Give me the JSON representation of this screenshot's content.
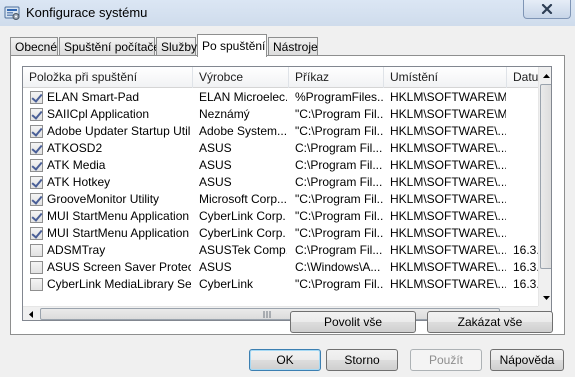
{
  "window": {
    "title": "Konfigurace systému"
  },
  "tabs": [
    {
      "label": "Obecné"
    },
    {
      "label": "Spuštění počítače"
    },
    {
      "label": "Služby"
    },
    {
      "label": "Po spuštění"
    },
    {
      "label": "Nástroje"
    }
  ],
  "active_tab": "Po spuštění",
  "columns": [
    {
      "label": "Položka při spuštění"
    },
    {
      "label": "Výrobce"
    },
    {
      "label": "Příkaz"
    },
    {
      "label": "Umístění"
    },
    {
      "label": "Datu..."
    }
  ],
  "rows": [
    {
      "checked": true,
      "name": "ELAN Smart-Pad",
      "vendor": "ELAN Microelec...",
      "command": "%ProgramFiles...",
      "location": "HKLM\\SOFTWARE\\M...",
      "date": ""
    },
    {
      "checked": true,
      "name": "SAIICpl Application",
      "vendor": "Neznámý",
      "command": "\"C:\\Program Fil...",
      "location": "HKLM\\SOFTWARE\\M...",
      "date": ""
    },
    {
      "checked": true,
      "name": "Adobe Updater Startup Utility",
      "vendor": "Adobe System...",
      "command": "\"C:\\Program Fil...",
      "location": "HKLM\\SOFTWARE\\...",
      "date": ""
    },
    {
      "checked": true,
      "name": "ATKOSD2",
      "vendor": "ASUS",
      "command": "C:\\Program Fil...",
      "location": "HKLM\\SOFTWARE\\...",
      "date": ""
    },
    {
      "checked": true,
      "name": "ATK Media",
      "vendor": "ASUS",
      "command": "C:\\Program Fil...",
      "location": "HKLM\\SOFTWARE\\...",
      "date": ""
    },
    {
      "checked": true,
      "name": "ATK Hotkey",
      "vendor": "ASUS",
      "command": "C:\\Program Fil...",
      "location": "HKLM\\SOFTWARE\\...",
      "date": ""
    },
    {
      "checked": true,
      "name": "GrooveMonitor Utility",
      "vendor": "Microsoft Corp...",
      "command": "\"C:\\Program Fil...",
      "location": "HKLM\\SOFTWARE\\...",
      "date": ""
    },
    {
      "checked": true,
      "name": "MUI StartMenu Application",
      "vendor": "CyberLink Corp.",
      "command": "\"C:\\Program Fil...",
      "location": "HKLM\\SOFTWARE\\...",
      "date": ""
    },
    {
      "checked": true,
      "name": "MUI StartMenu Application",
      "vendor": "CyberLink Corp.",
      "command": "\"C:\\Program Fil...",
      "location": "HKLM\\SOFTWARE\\...",
      "date": ""
    },
    {
      "checked": false,
      "name": "ADSMTray",
      "vendor": "ASUSTek Comp...",
      "command": "C:\\Program Fil...",
      "location": "HKLM\\SOFTWARE\\...",
      "date": "16.3..."
    },
    {
      "checked": false,
      "name": "ASUS Screen Saver Protector",
      "vendor": "ASUS",
      "command": "C:\\Windows\\A...",
      "location": "HKLM\\SOFTWARE\\...",
      "date": "16.3..."
    },
    {
      "checked": false,
      "name": "CyberLink MediaLibrary Service",
      "vendor": "CyberLink",
      "command": "\"C:\\Program Fil...",
      "location": "HKLM\\SOFTWARE\\...",
      "date": "16.3..."
    }
  ],
  "panel_buttons": {
    "enable_all": "Povolit vše",
    "disable_all": "Zakázat vše"
  },
  "dialog_buttons": {
    "ok": "OK",
    "cancel": "Storno",
    "apply": "Použít",
    "help": "Nápověda"
  },
  "icons": {
    "title": "msconfig-icon",
    "close": "close-icon"
  }
}
